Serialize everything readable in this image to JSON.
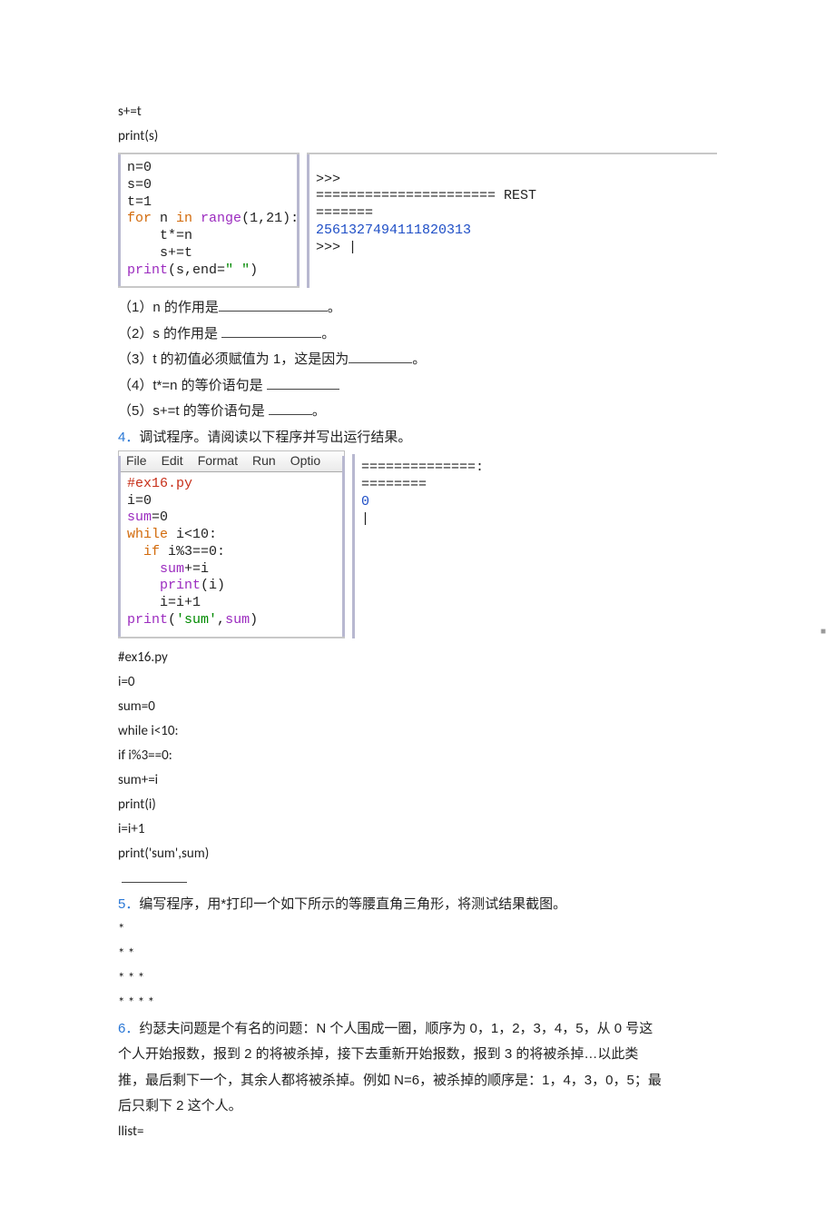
{
  "top_code": {
    "l1": "s+=t",
    "l2": "print(s)"
  },
  "editor1": {
    "l1a": "n",
    "l1b": "=0",
    "l2a": "s",
    "l2b": "=0",
    "l3a": "t",
    "l3b": "=1",
    "l4a": "for",
    "l4b": " n ",
    "l4c": "in",
    "l4d": " range",
    "l4e": "(1,21):",
    "l5": "    t*=n",
    "l6": "    s+=t",
    "l7a": "print",
    "l7b": "(s,",
    "l7c": "end",
    "l7d": "=",
    "l7e": "\" \"",
    "l7f": ")"
  },
  "shell1": {
    "prompt1": ">>>",
    "rest": "====================== REST",
    "eq": "=======",
    "number": "2561327494111820313",
    "prompt2": ">>> |"
  },
  "subq": {
    "q1a": "（1）n 的作用是",
    "q1b": "。",
    "q2a": "（2）s 的作用是 ",
    "q2b": "。",
    "q3a": "（3）t 的初值必须赋值为 1，这是因为",
    "q3b": "。",
    "q4a": "（4）t*=n 的等价语句是 ",
    "q5a": "（5）s+=t 的等价语句是 ",
    "q5b": "。"
  },
  "q4": {
    "num": "4．",
    "text": "调试程序。请阅读以下程序并写出运行结果。"
  },
  "menubar": {
    "m1": "File",
    "m2": "Edit",
    "m3": "Format",
    "m4": "Run",
    "m5": "Optio"
  },
  "editor2": {
    "l1": "#ex16.py",
    "l2a": "i",
    "l2b": "=0",
    "l3a": "sum",
    "l3b": "=0",
    "l4a": "while",
    "l4b": " i<10:",
    "l5a": "  if",
    "l5b": " i%3==0:",
    "l6a": "    sum",
    "l6b": "+=i",
    "l7a": "    print",
    "l7b": "(i)",
    "l8": "    i=i+1",
    "l9a": "print",
    "l9b": "(",
    "l9c": "'sum'",
    "l9d": ",",
    "l9e": "sum",
    "l9f": ")"
  },
  "shell2": {
    "eq1": "==============:",
    "eq2": "========",
    "out": "0",
    "cur": "|"
  },
  "listing": {
    "l1": "#ex16.py",
    "l2": "i=0",
    "l3": "sum=0",
    "l4": "while i<10:",
    "l5": "  if i%3==0:",
    "l6": "    sum+=i",
    "l7": "    print(i)",
    "l8": "    i=i+1",
    "l9": "print('sum',sum)"
  },
  "q5": {
    "num": "5．",
    "text": "编写程序，用*打印一个如下所示的等腰直角三角形，将测试结果截图。",
    "star1": "*",
    "star2": "* *",
    "star3": "* * *",
    "star4": "* * * *"
  },
  "q6": {
    "num": "6．",
    "p1": "约瑟夫问题是个有名的问题：N 个人围成一圈，顺序为 0，1，2，3，4，5，从 0 号这",
    "p2": "个人开始报数，报到 2 的将被杀掉，接下去重新开始报数，报到 3 的将被杀掉…以此类",
    "p3": "推，最后剩下一个，其余人都将被杀掉。例如 N=6，被杀掉的顺序是：1，4，3，0，5；最",
    "p4": "后只剩下 2 这个人。",
    "p5": "llist="
  },
  "tiny_mark": "■"
}
